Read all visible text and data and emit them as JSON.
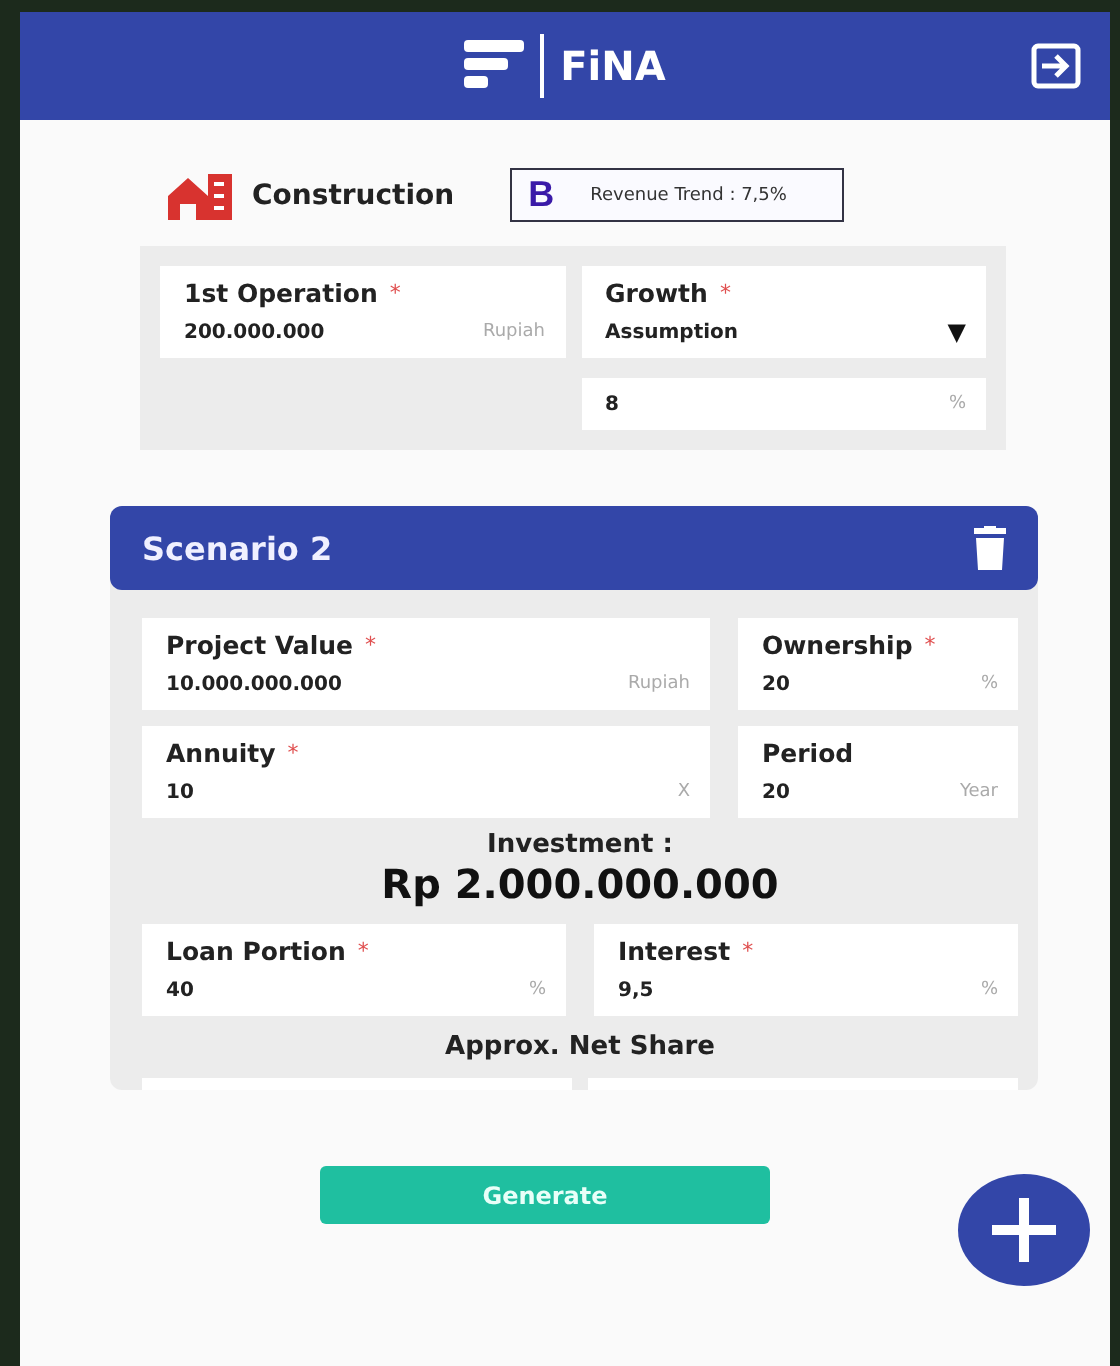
{
  "header": {
    "title": "FiNA"
  },
  "company": {
    "sector": "Construction",
    "badge_letter": "B",
    "badge_text": "Revenue Trend : 7,5%"
  },
  "top_left": [
    {
      "kind": "input",
      "label": "1st Operation",
      "required_mark": "*",
      "value": "200.000.000",
      "unit": "Rupiah"
    }
  ],
  "top_right": [
    {
      "kind": "select",
      "label": "Growth",
      "required_mark": "*",
      "value": "Assumption",
      "caret": "▼"
    },
    {
      "kind": "input",
      "value": "8",
      "unit": "%"
    }
  ],
  "scenario": {
    "title": "Scenario 2",
    "rows": [
      [
        {
          "kind": "input",
          "label": "Project Value",
          "required_mark": "*",
          "value": "10.000.000.000",
          "unit": "Rupiah"
        },
        {
          "kind": "input",
          "label": "Ownership",
          "required_mark": "*",
          "value": "20",
          "unit": "%"
        }
      ],
      [
        {
          "kind": "input",
          "label": "Annuity",
          "required_mark": "*",
          "value": "10",
          "unit": "X"
        },
        {
          "kind": "input",
          "label": "Period",
          "value": "20",
          "unit": "Year"
        }
      ]
    ],
    "investment_label": "Investment :",
    "investment_value": "Rp 2.000.000.000",
    "loan_rows": [
      [
        {
          "kind": "input",
          "label": "Loan Portion",
          "required_mark": "*",
          "value": "40",
          "unit": "%"
        },
        {
          "kind": "input",
          "label": "Interest",
          "required_mark": "*",
          "value": "9,5",
          "unit": "%"
        }
      ]
    ],
    "net_share_label": "Approx. Net Share"
  },
  "generate_button": "Generate"
}
